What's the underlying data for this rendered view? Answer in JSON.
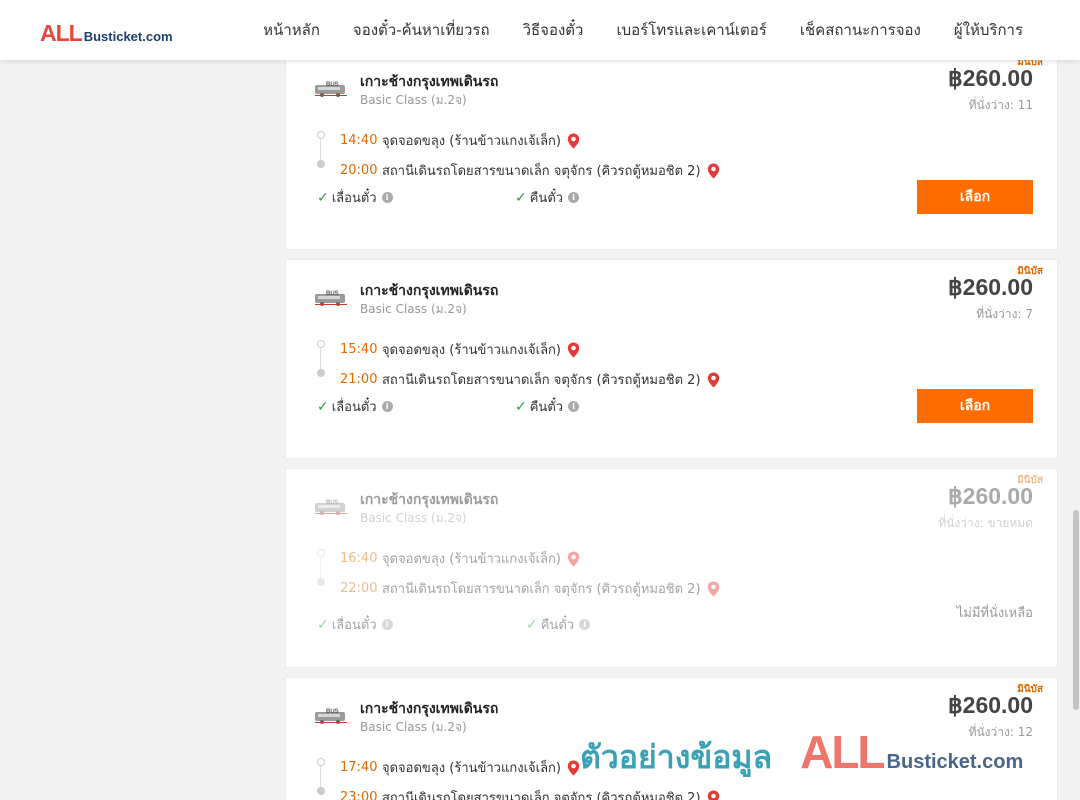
{
  "header": {
    "logo_all": "ALL",
    "logo_rest": "Busticket.com",
    "nav": [
      "หน้าหลัก",
      "จองตั๋ว-ค้นหาเที่ยวรถ",
      "วิธีจองตั๋ว",
      "เบอร์โทรและเคาน์เตอร์",
      "เช็คสถานะการจอง",
      "ผู้ให้บริการ"
    ]
  },
  "trips": [
    {
      "badge": "มินิบัส",
      "operator": "เกาะช้างกรุงเทพเดินรถ",
      "class": "Basic Class (ม.2จ)",
      "price": "฿260.00",
      "seats": "ที่นั่งว่าง: 11",
      "depart_time": "14:40",
      "depart_place": "จุดจอดขลุง (ร้านข้าวแกงเจ้เล็ก)",
      "arrive_time": "20:00",
      "arrive_place": "สถานีเดินรถโดยสารขนาดเล็ก จตุจักร (คิวรถตู้หมอชิต 2)",
      "feature_change": "เลื่อนตั๋ว",
      "feature_refund": "คืนตั๋ว",
      "button": "เลือก"
    },
    {
      "badge": "มินิบัส",
      "operator": "เกาะช้างกรุงเทพเดินรถ",
      "class": "Basic Class (ม.2จ)",
      "price": "฿260.00",
      "seats": "ที่นั่งว่าง: 7",
      "depart_time": "15:40",
      "depart_place": "จุดจอดขลุง (ร้านข้าวแกงเจ้เล็ก)",
      "arrive_time": "21:00",
      "arrive_place": "สถานีเดินรถโดยสารขนาดเล็ก จตุจักร (คิวรถตู้หมอชิต 2)",
      "feature_change": "เลื่อนตั๋ว",
      "feature_refund": "คืนตั๋ว",
      "button": "เลือก"
    },
    {
      "badge": "มินิบัส",
      "operator": "เกาะช้างกรุงเทพเดินรถ",
      "class": "Basic Class (ม.2จ)",
      "price": "฿260.00",
      "seats": "ที่นั่งว่าง: ขายหมด",
      "depart_time": "16:40",
      "depart_place": "จุดจอดขลุง (ร้านข้าวแกงเจ้เล็ก)",
      "arrive_time": "22:00",
      "arrive_place": "สถานีเดินรถโดยสารขนาดเล็ก จตุจักร (คิวรถตู้หมอชิต 2)",
      "feature_change": "เลื่อนตั๋ว",
      "feature_refund": "คืนตั๋ว",
      "soldout_note": "ไม่มีที่นั่งเหลือ"
    },
    {
      "badge": "มินิบัส",
      "operator": "เกาะช้างกรุงเทพเดินรถ",
      "class": "Basic Class (ม.2จ)",
      "price": "฿260.00",
      "seats": "ที่นั่งว่าง: 12",
      "depart_time": "17:40",
      "depart_place": "จุดจอดขลุง (ร้านข้าวแกงเจ้เล็ก)",
      "arrive_time": "23:00",
      "arrive_place": "สถานีเดินรถโดยสารขนาดเล็ก จตุจักร (คิวรถตู้หมอชิต 2)"
    }
  ],
  "watermark": {
    "thai": "ตัวอย่างข้อมูล",
    "all": "ALL",
    "rest": "Busticket.com"
  },
  "colors": {
    "accent": "#ff6d00",
    "time": "#e06a00",
    "pin": "#e53935",
    "check": "#2e9e3e"
  }
}
